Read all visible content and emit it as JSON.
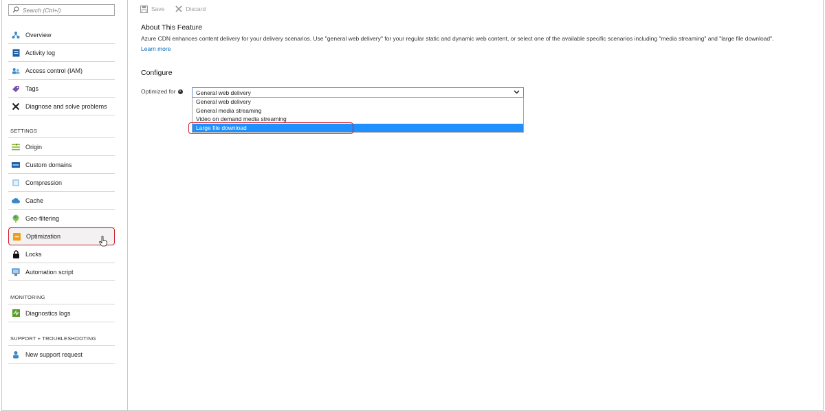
{
  "search": {
    "placeholder": "Search (Ctrl+/)"
  },
  "nav_top": [
    {
      "label": "Overview",
      "icon": "overview-icon"
    },
    {
      "label": "Activity log",
      "icon": "activity-log-icon"
    },
    {
      "label": "Access control (IAM)",
      "icon": "iam-icon"
    },
    {
      "label": "Tags",
      "icon": "tag-icon"
    },
    {
      "label": "Diagnose and solve problems",
      "icon": "wrench-icon"
    }
  ],
  "sections": {
    "settings": "SETTINGS",
    "monitoring": "MONITORING",
    "support": "SUPPORT + TROUBLESHOOTING"
  },
  "nav_settings": [
    {
      "label": "Origin",
      "icon": "origin-icon"
    },
    {
      "label": "Custom domains",
      "icon": "custom-domains-icon"
    },
    {
      "label": "Compression",
      "icon": "compression-icon"
    },
    {
      "label": "Cache",
      "icon": "cache-icon"
    },
    {
      "label": "Geo-filtering",
      "icon": "globe-icon"
    },
    {
      "label": "Optimization",
      "icon": "optimization-icon"
    },
    {
      "label": "Locks",
      "icon": "lock-icon"
    },
    {
      "label": "Automation script",
      "icon": "automation-icon"
    }
  ],
  "nav_monitoring": [
    {
      "label": "Diagnostics logs",
      "icon": "diagnostics-icon"
    }
  ],
  "nav_support": [
    {
      "label": "New support request",
      "icon": "support-icon"
    }
  ],
  "toolbar": {
    "save": "Save",
    "discard": "Discard"
  },
  "about": {
    "title": "About This Feature",
    "description": "Azure CDN enhances content delivery for your delivery scenarios. Use \"general web delivery\" for your regular static and dynamic web content, or select one of the available specific scenarios including \"media streaming\" and \"large file download\".",
    "learn_more": "Learn more"
  },
  "configure": {
    "title": "Configure",
    "optimized_label": "Optimized for",
    "selected": "General web delivery",
    "options": [
      "General web delivery",
      "General media streaming",
      "Video on demand media streaming",
      "Large file download"
    ],
    "hovered_option": "Large file download"
  },
  "colors": {
    "accent": "#0068b8",
    "highlight": "#d0202a",
    "selected": "#1e90ff"
  }
}
